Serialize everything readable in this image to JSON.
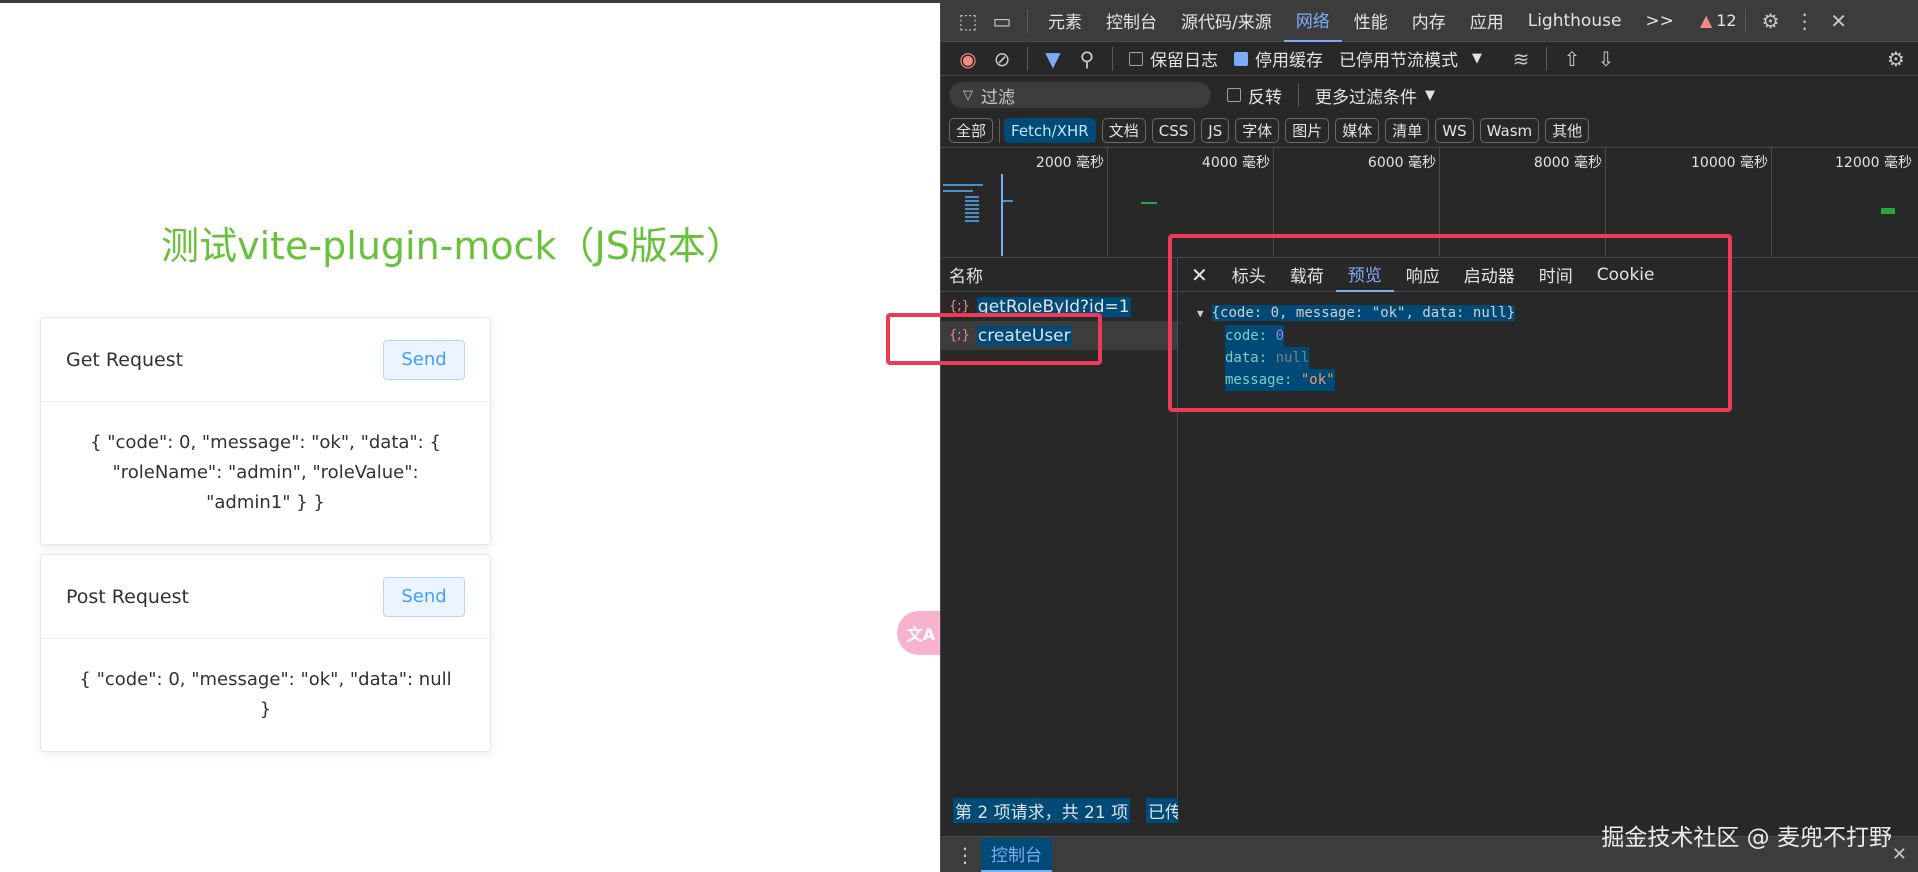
{
  "page": {
    "title": "测试vite-plugin-mock（JS版本）",
    "get_card": {
      "title": "Get Request",
      "button": "Send",
      "result": "{ \"code\": 0, \"message\": \"ok\", \"data\": { \"roleName\": \"admin\", \"roleValue\": \"admin1\" } }"
    },
    "post_card": {
      "title": "Post Request",
      "button": "Send",
      "result": "{ \"code\": 0, \"message\": \"ok\", \"data\": null }"
    },
    "translate_label": "文A"
  },
  "devtools": {
    "tabs": [
      "元素",
      "控制台",
      "源代码/来源",
      "网络",
      "性能",
      "内存",
      "应用",
      "Lighthouse"
    ],
    "active_tab": "网络",
    "more_tabs": ">>",
    "warning_count": "12",
    "toolbar": {
      "preserve_log": "保留日志",
      "disable_cache": "停用缓存",
      "throttle": "已停用节流模式"
    },
    "filter": {
      "placeholder": "过滤",
      "invert": "反转",
      "more_filters": "更多过滤条件"
    },
    "types": [
      "全部",
      "Fetch/XHR",
      "文档",
      "CSS",
      "JS",
      "字体",
      "图片",
      "媒体",
      "清单",
      "WS",
      "Wasm",
      "其他"
    ],
    "active_type": "Fetch/XHR",
    "timeline_ticks": [
      "2000 毫秒",
      "4000 毫秒",
      "6000 毫秒",
      "8000 毫秒",
      "10000 毫秒",
      "12000 毫秒"
    ],
    "name_header": "名称",
    "requests": [
      "getRoleById?id=1",
      "createUser"
    ],
    "detail_tabs": [
      "标头",
      "载荷",
      "预览",
      "响应",
      "启动器",
      "时间",
      "Cookie"
    ],
    "active_detail_tab": "预览",
    "preview": {
      "summary": "{code: 0, message: \"ok\", data: null}",
      "code_key": "code",
      "code_val": "0",
      "data_key": "data",
      "data_val": "null",
      "message_key": "message",
      "message_val": "\"ok\""
    },
    "status": "第 2 项请求，共 21 项",
    "status_more": "已传",
    "drawer_tab": "控制台"
  },
  "watermark": "掘金技术社区 @ 麦兜不打野"
}
